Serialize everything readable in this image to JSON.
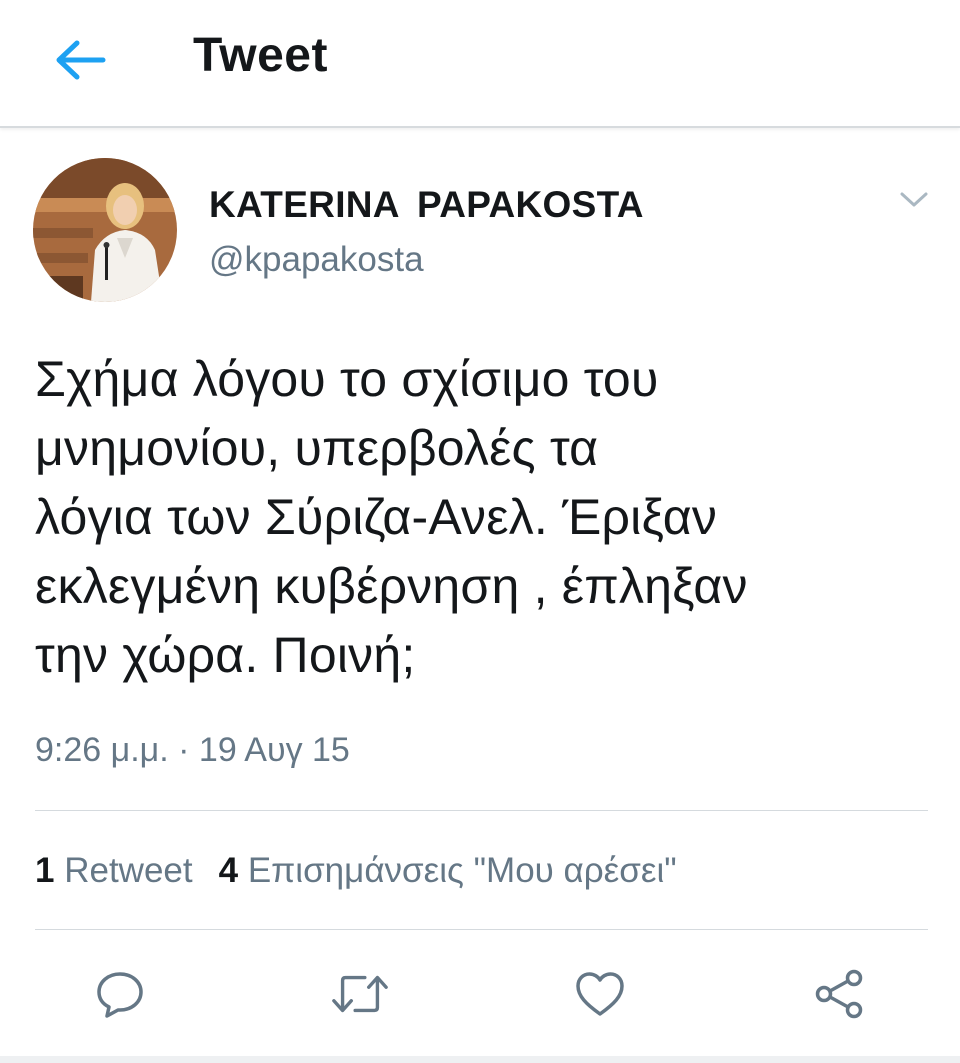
{
  "header": {
    "title": "Tweet",
    "back_icon": "arrow-left-icon",
    "accent_color": "#1da1f2"
  },
  "tweet": {
    "author_name": "KATERINA  PAPAKOSTA",
    "author_handle": "@kpapakosta",
    "text": "Σχήμα λόγου το σχίσιμο του\nμνημονίου, υπερβολές τα\nλόγια των Σύριζα-Ανελ. Έριξαν\nεκλεγμένη κυβέρνηση , έπληξαν\nτην χώρα. Ποινή;",
    "timestamp": "9:26 μ.μ. · 19 Αυγ 15"
  },
  "stats": {
    "retweet_count": "1",
    "retweet_label": "Retweet",
    "like_count": "4",
    "like_label": "Επισημάνσεις \"Μου αρέσει\""
  },
  "actions": [
    {
      "name": "reply",
      "icon": "reply-icon"
    },
    {
      "name": "retweet",
      "icon": "retweet-icon"
    },
    {
      "name": "like",
      "icon": "heart-icon"
    },
    {
      "name": "share",
      "icon": "share-icon"
    }
  ]
}
